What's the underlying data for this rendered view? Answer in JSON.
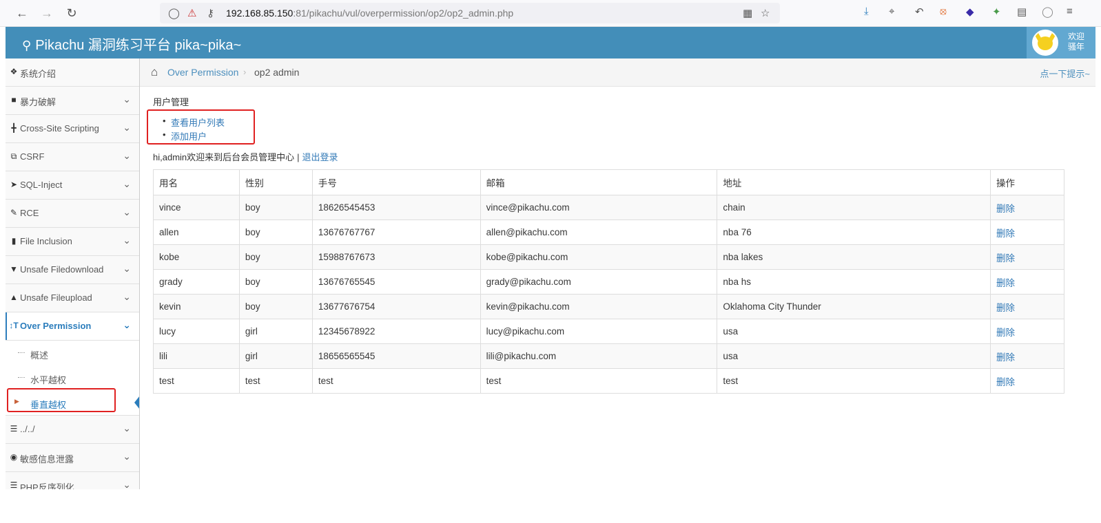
{
  "browser": {
    "url_host": "192.168.85.150",
    "url_rest": ":81/pikachu/vul/overpermission/op2/op2_admin.php"
  },
  "header": {
    "brand": "Pikachu 漏洞练习平台 pika~pika~",
    "welcome_line1": "欢迎",
    "welcome_line2": "骚年"
  },
  "sidebar": {
    "items": [
      {
        "label": "系统介绍",
        "icon": "tags-icon"
      },
      {
        "label": "暴力破解",
        "icon": "lock-icon"
      },
      {
        "label": "Cross-Site Scripting",
        "icon": "xss-icon"
      },
      {
        "label": "CSRF",
        "icon": "share-icon"
      },
      {
        "label": "SQL-Inject",
        "icon": "plane-icon"
      },
      {
        "label": "RCE",
        "icon": "pencil-icon"
      },
      {
        "label": "File Inclusion",
        "icon": "file-icon"
      },
      {
        "label": "Unsafe Filedownload",
        "icon": "download-circle-icon"
      },
      {
        "label": "Unsafe Fileupload",
        "icon": "upload-circle-icon"
      },
      {
        "label": "Over Permission",
        "icon": "text-height-icon"
      },
      {
        "label": "../../",
        "icon": "align-left-icon"
      },
      {
        "label": "敏感信息泄露",
        "icon": "camera-icon"
      },
      {
        "label": "PHP反序列化",
        "icon": "align-left-icon"
      }
    ],
    "sub_items": [
      {
        "label": "概述"
      },
      {
        "label": "水平越权"
      },
      {
        "label": "垂直越权"
      }
    ]
  },
  "breadcrumbs": {
    "link": "Over Permission",
    "current": "op2 admin",
    "hint": "点一下提示~"
  },
  "content": {
    "section_title": "用户管理",
    "menu": [
      "查看用户列表",
      "添加用户"
    ],
    "welcome_text": "hi,admin欢迎来到后台会员管理中心",
    "separator": "|",
    "logout": "退出登录"
  },
  "table": {
    "headers": [
      "用名",
      "性别",
      "手号",
      "邮箱",
      "地址",
      "操作"
    ],
    "rows": [
      [
        "vince",
        "boy",
        "18626545453",
        "vince@pikachu.com",
        "chain",
        "删除"
      ],
      [
        "allen",
        "boy",
        "13676767767",
        "allen@pikachu.com",
        "nba 76",
        "删除"
      ],
      [
        "kobe",
        "boy",
        "15988767673",
        "kobe@pikachu.com",
        "nba lakes",
        "删除"
      ],
      [
        "grady",
        "boy",
        "13676765545",
        "grady@pikachu.com",
        "nba hs",
        "删除"
      ],
      [
        "kevin",
        "boy",
        "13677676754",
        "kevin@pikachu.com",
        "Oklahoma City Thunder",
        "删除"
      ],
      [
        "lucy",
        "girl",
        "12345678922",
        "lucy@pikachu.com",
        "usa",
        "删除"
      ],
      [
        "lili",
        "girl",
        "18656565545",
        "lili@pikachu.com",
        "usa",
        "删除"
      ],
      [
        "test",
        "test",
        "test",
        "test",
        "test",
        "删除"
      ]
    ]
  }
}
